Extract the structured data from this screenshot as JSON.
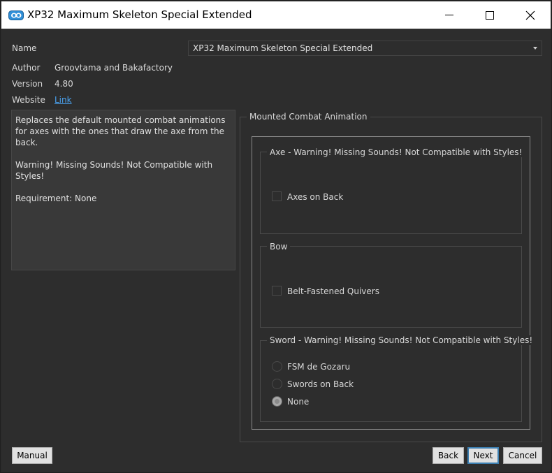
{
  "window": {
    "title": "XP32 Maximum Skeleton Special Extended"
  },
  "info": {
    "name_label": "Name",
    "name_value": "XP32 Maximum Skeleton Special Extended",
    "author_label": "Author",
    "author_value": "Groovtama and Bakafactory",
    "version_label": "Version",
    "version_value": "4.80",
    "website_label": "Website",
    "website_link": "Link"
  },
  "description": {
    "line1": "Replaces the default mounted combat animations for axes with the ones that draw the axe from the back.",
    "line2": "Warning! Missing Sounds! Not Compatible with Styles!",
    "line3": "Requirement: None"
  },
  "options": {
    "group_title": "Mounted Combat Animation",
    "axe": {
      "title": "Axe - Warning! Missing Sounds! Not Compatible with Styles!",
      "checkbox_label": "Axes on Back",
      "checked": false
    },
    "bow": {
      "title": "Bow",
      "checkbox_label": "Belt-Fastened Quivers",
      "checked": false
    },
    "sword": {
      "title": "Sword - Warning! Missing Sounds! Not Compatible with Styles!",
      "radios": [
        {
          "label": "FSM de Gozaru",
          "checked": false
        },
        {
          "label": "Swords on Back",
          "checked": false
        },
        {
          "label": "None",
          "checked": true
        }
      ]
    }
  },
  "buttons": {
    "manual": "Manual",
    "back": "Back",
    "next": "Next",
    "cancel": "Cancel"
  },
  "colors": {
    "background": "#2d2d2d",
    "link": "#4aa3f0",
    "default_button_border": "#3c7fb1"
  }
}
